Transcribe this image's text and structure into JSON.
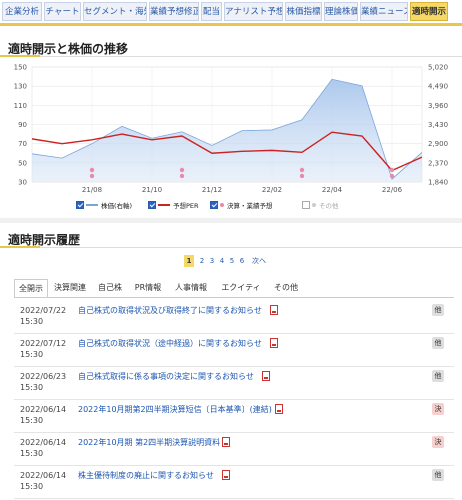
{
  "top_tabs": [
    {
      "label": "企業分析",
      "active": false
    },
    {
      "label": "チャート",
      "active": false
    },
    {
      "label": "セグメント・海外",
      "active": false
    },
    {
      "label": "業績予想修正",
      "active": false
    },
    {
      "label": "配当",
      "active": false
    },
    {
      "label": "アナリスト予想",
      "active": false
    },
    {
      "label": "株価指標",
      "active": false
    },
    {
      "label": "理論株価",
      "active": false
    },
    {
      "label": "業績ニュース",
      "active": false
    },
    {
      "label": "適時開示",
      "active": true
    }
  ],
  "chart_section": {
    "title": "適時開示と株価の推移"
  },
  "chart_data": {
    "type": "line",
    "x": [
      "21/06",
      "21/07",
      "21/08",
      "21/09",
      "21/10",
      "21/11",
      "21/12",
      "22/01",
      "22/02",
      "22/03",
      "22/04",
      "22/05",
      "22/06",
      "22/07"
    ],
    "x_ticks": [
      "21/08",
      "21/10",
      "21/12",
      "22/02",
      "22/04",
      "22/06"
    ],
    "y_left_ticks": [
      30,
      50,
      70,
      90,
      110,
      130,
      150
    ],
    "y_left_range": [
      30,
      150
    ],
    "y_right_ticks": [
      "1,840",
      "2,370",
      "2,900",
      "3,430",
      "3,960",
      "4,490",
      "5,020"
    ],
    "y_right_range": [
      1840,
      5020
    ],
    "series": [
      {
        "name": "株価(右軸)",
        "axis": "right",
        "color": "#7aa5db",
        "values": [
          2620,
          2500,
          2900,
          3380,
          3050,
          3230,
          2850,
          3260,
          3280,
          3560,
          4680,
          4500,
          1920,
          2660
        ]
      },
      {
        "name": "予想PER",
        "axis": "left",
        "color": "#cc2222",
        "values": [
          75,
          70,
          74,
          80,
          74,
          78,
          60,
          62,
          63,
          61,
          82,
          78,
          42,
          56
        ]
      }
    ],
    "event_markers": [
      {
        "x": "21/08",
        "color": "#e88aa8"
      },
      {
        "x": "21/11",
        "color": "#e88aa8"
      },
      {
        "x": "22/03",
        "color": "#e88aa8"
      },
      {
        "x": "22/06",
        "color": "#e88aa8"
      }
    ],
    "legend": [
      {
        "label": "株価(右軸)",
        "checked": true,
        "kind": "swatch",
        "color": "#7aa5db"
      },
      {
        "label": "予想PER",
        "checked": true,
        "kind": "swatch",
        "color": "#cc2222"
      },
      {
        "label": "決算・業績予想",
        "checked": true,
        "kind": "dot",
        "color": "#e88aa8"
      },
      {
        "label": "その他",
        "checked": false,
        "kind": "dot",
        "color": "#cccccc"
      }
    ],
    "grid": true
  },
  "history_section": {
    "title": "適時開示履歴"
  },
  "pagination": {
    "current": "1",
    "pages": [
      "2",
      "3",
      "4",
      "5",
      "6"
    ],
    "next": "次へ"
  },
  "sub_tabs": [
    {
      "label": "全開示",
      "active": true
    },
    {
      "label": "決算関連",
      "active": false
    },
    {
      "label": "自己株",
      "active": false
    },
    {
      "label": "PR情報",
      "active": false
    },
    {
      "label": "人事情報",
      "active": false
    },
    {
      "label": "エクイティ",
      "active": false
    },
    {
      "label": "その他",
      "active": false
    }
  ],
  "rows": [
    {
      "date": "2022/07/22",
      "time": "15:30",
      "title": "自己株式の取得状況及び取得終了に関するお知らせ",
      "badge": "他",
      "badge_kind": "other"
    },
    {
      "date": "2022/07/12",
      "time": "15:30",
      "title": "自己株式の取得状況（途中経過）に関するお知らせ",
      "badge": "他",
      "badge_kind": "other"
    },
    {
      "date": "2022/06/23",
      "time": "15:30",
      "title": "自己株式取得に係る事項の決定に関するお知らせ",
      "badge": "他",
      "badge_kind": "other"
    },
    {
      "date": "2022/06/14",
      "time": "15:30",
      "title": "2022年10月期第2四半期決算短信〔日本基準〕(連結)",
      "badge": "決",
      "badge_kind": "kessan"
    },
    {
      "date": "2022/06/14",
      "time": "15:30",
      "title": "2022年10月期 第2四半期決算説明資料",
      "badge": "決",
      "badge_kind": "kessan"
    },
    {
      "date": "2022/06/14",
      "time": "15:30",
      "title": "株主優待制度の廃止に関するお知らせ",
      "badge": "他",
      "badge_kind": "other"
    }
  ]
}
